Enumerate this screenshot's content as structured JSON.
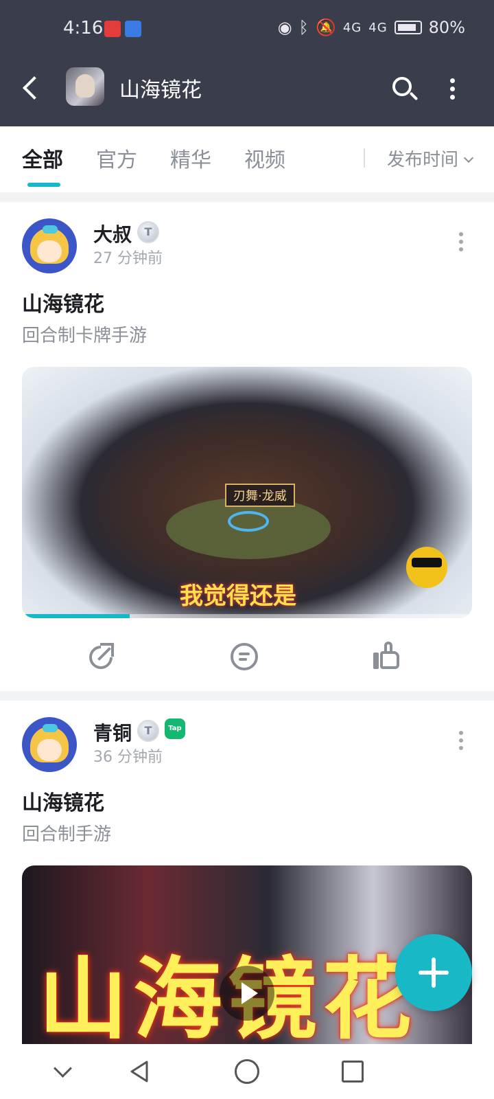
{
  "status_bar": {
    "time": "4:16",
    "network1": "4G",
    "network2": "4G",
    "battery": "80%"
  },
  "app_bar": {
    "title": "山海镜花",
    "icons": [
      "back-arrow-icon",
      "search-icon",
      "more-vertical-icon"
    ]
  },
  "tabs": {
    "items": [
      "全部",
      "官方",
      "精华",
      "视频"
    ],
    "active_index": 0,
    "sort_label": "发布时间"
  },
  "posts": [
    {
      "author": "大叔",
      "level": "T",
      "time_ago": "27 分钟前",
      "title": "山海镜花",
      "description": "回合制卡牌手游",
      "media": {
        "type": "video",
        "overlay_label": "刃舞·龙威",
        "caption": "我觉得还是",
        "progress": 0.24
      }
    },
    {
      "author": "青铜",
      "level": "T",
      "badge": "Tap",
      "time_ago": "36 分钟前",
      "title": "山海镜花",
      "description": "回合制手游",
      "media": {
        "type": "video",
        "overlay_title": "山海镜花"
      }
    }
  ],
  "colors": {
    "header_bg": "#3a3d4b",
    "accent": "#14b9c8",
    "muted_text": "#8b8f98"
  }
}
